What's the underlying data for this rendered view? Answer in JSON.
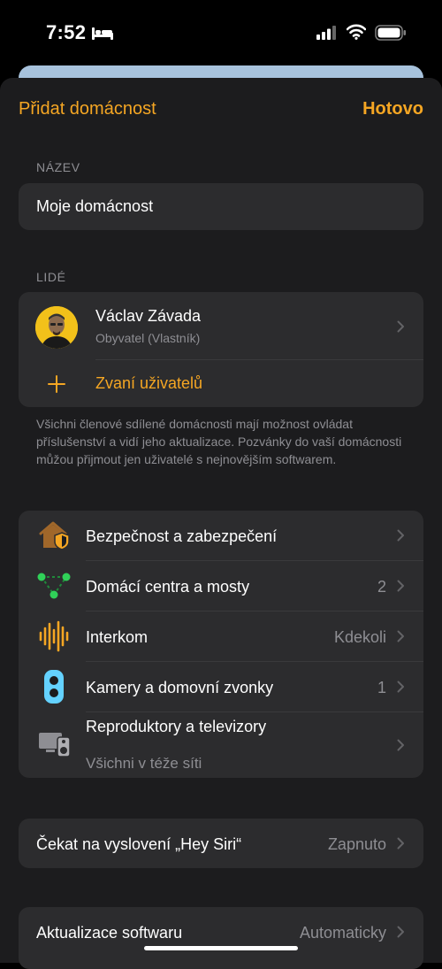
{
  "status_bar": {
    "time": "7:52"
  },
  "nav": {
    "left_label": "Přidat domácnost",
    "done_label": "Hotovo"
  },
  "name_section": {
    "header": "NÁZEV",
    "value": "Moje domácnost"
  },
  "people_section": {
    "header": "LIDÉ",
    "owner_name": "Václav Závada",
    "owner_role": "Obyvatel (Vlastník)",
    "invite_label": "Zvaní uživatelů",
    "footer": "Všichni členové sdílené domácnosti mají možnost ovládat příslušenství a vidí jeho aktualizace. Pozvánky do vaší domácnosti můžou přijmout jen uživatelé s nejnovějším softwarem."
  },
  "settings": [
    {
      "label": "Bezpečnost a zabezpečení",
      "value": "",
      "icon": "house-shield-icon"
    },
    {
      "label": "Domácí centra a mosty",
      "value": "2",
      "icon": "hub-network-icon"
    },
    {
      "label": "Interkom",
      "value": "Kdekoli",
      "icon": "intercom-waveform-icon"
    },
    {
      "label": "Kamery a domovní zvonky",
      "value": "1",
      "icon": "camera-icon"
    },
    {
      "label": "Reproduktory a televizory",
      "sublabel": "Všichni v téže síti",
      "icon": "speaker-tv-icon"
    }
  ],
  "siri": {
    "label": "Čekat na vyslovení „Hey Siri“",
    "value": "Zapnuto"
  },
  "update": {
    "label": "Aktualizace softwaru",
    "value": "Automaticky"
  },
  "colors": {
    "accent": "#f5a623",
    "card": "#2c2c2e",
    "sheet": "#1c1c1e",
    "secondary_text": "#8e8e93"
  }
}
